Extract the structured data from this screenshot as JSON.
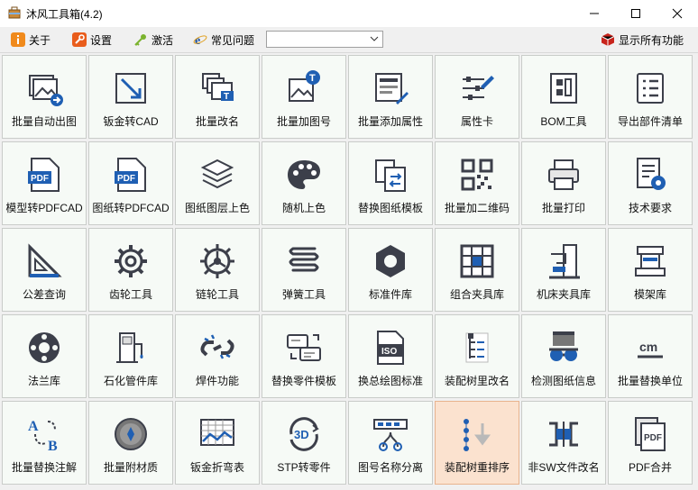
{
  "window": {
    "title": "沐风工具箱(4.2)"
  },
  "toolbar": {
    "about": "关于",
    "settings": "设置",
    "activate": "激活",
    "faq": "常见问题",
    "combo_value": "",
    "show_all": "显示所有功能"
  },
  "tiles": [
    {
      "label": "批量自动出图",
      "icon": "image-export-icon"
    },
    {
      "label": "钣金转CAD",
      "icon": "expand-arrow-icon"
    },
    {
      "label": "批量改名",
      "icon": "rename-icon"
    },
    {
      "label": "批量加图号",
      "icon": "image-text-icon"
    },
    {
      "label": "批量添加属性",
      "icon": "properties-edit-icon"
    },
    {
      "label": "属性卡",
      "icon": "sliders-pencil-icon"
    },
    {
      "label": "BOM工具",
      "icon": "bom-icon"
    },
    {
      "label": "导出部件清单",
      "icon": "list-icon"
    },
    {
      "label": "模型转PDFCAD",
      "icon": "pdf-file-icon"
    },
    {
      "label": "图纸转PDFCAD",
      "icon": "pdf-file-icon"
    },
    {
      "label": "图纸图层上色",
      "icon": "layers-icon"
    },
    {
      "label": "随机上色",
      "icon": "palette-icon"
    },
    {
      "label": "替换图纸模板",
      "icon": "replace-template-icon"
    },
    {
      "label": "批量加二维码",
      "icon": "qr-code-icon"
    },
    {
      "label": "批量打印",
      "icon": "printer-icon"
    },
    {
      "label": "技术要求",
      "icon": "doc-gear-icon"
    },
    {
      "label": "公差查询",
      "icon": "triangle-ruler-icon"
    },
    {
      "label": "齿轮工具",
      "icon": "gear-icon"
    },
    {
      "label": "链轮工具",
      "icon": "sprocket-icon"
    },
    {
      "label": "弹簧工具",
      "icon": "spring-icon"
    },
    {
      "label": "标准件库",
      "icon": "hex-nut-icon"
    },
    {
      "label": "组合夹具库",
      "icon": "fixture-grid-icon"
    },
    {
      "label": "机床夹具库",
      "icon": "machine-icon"
    },
    {
      "label": "模架库",
      "icon": "mold-base-icon"
    },
    {
      "label": "法兰库",
      "icon": "flange-icon"
    },
    {
      "label": "石化管件库",
      "icon": "pipe-fitting-icon"
    },
    {
      "label": "焊件功能",
      "icon": "broken-link-icon"
    },
    {
      "label": "替换零件模板",
      "icon": "card-swap-icon"
    },
    {
      "label": "换总绘图标准",
      "icon": "iso-file-icon"
    },
    {
      "label": "装配树里改名",
      "icon": "tree-rename-icon"
    },
    {
      "label": "检测图纸信息",
      "icon": "inspector-icon"
    },
    {
      "label": "批量替换单位",
      "icon": "unit-cm-icon"
    },
    {
      "label": "批量替换注解",
      "icon": "a-to-b-icon"
    },
    {
      "label": "批量附材质",
      "icon": "material-icon"
    },
    {
      "label": "钣金折弯表",
      "icon": "bend-table-icon"
    },
    {
      "label": "STP转零件",
      "icon": "3d-rotate-icon"
    },
    {
      "label": "图号名称分离",
      "icon": "split-icon"
    },
    {
      "label": "装配树重排序",
      "icon": "tree-sort-icon"
    },
    {
      "label": "非SW文件改名",
      "icon": "file-rename-icon"
    },
    {
      "label": "PDF合并",
      "icon": "pdf-merge-icon"
    }
  ],
  "active_tile": 37,
  "colors": {
    "tile_bg": "#f6faf6",
    "tile_active_bg": "#fbe2cf",
    "icon_dark": "#3c3f4a",
    "icon_blue": "#1f5fb3"
  }
}
